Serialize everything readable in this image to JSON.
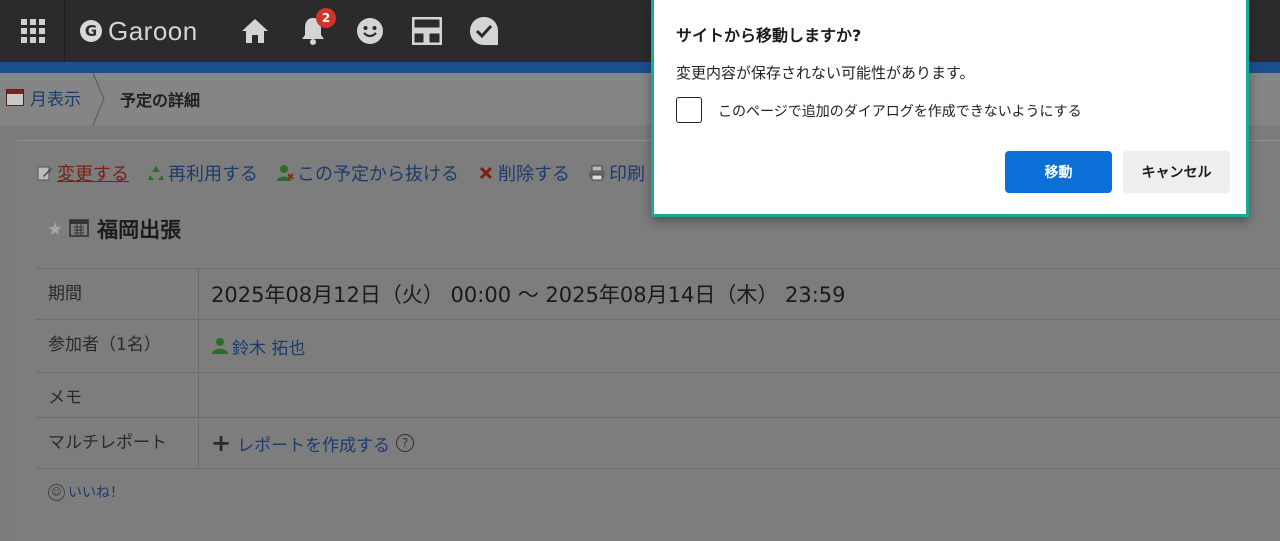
{
  "app": {
    "logo_text": "Garoon",
    "logo_mark": "G"
  },
  "topbar": {
    "icons": [
      "apps-grid-icon",
      "home-icon",
      "bell-icon",
      "smiley-icon",
      "portal-icon",
      "check-icon"
    ],
    "notification_count": "2",
    "accent_color": "#1b4f8c"
  },
  "breadcrumb": {
    "parent_label": "月表示",
    "current_label": "予定の詳細"
  },
  "actions": {
    "edit": "変更する",
    "reuse": "再利用する",
    "leave": "この予定から抜ける",
    "delete": "削除する",
    "print": "印刷"
  },
  "event": {
    "title": "福岡出張",
    "rows": [
      {
        "label": "期間",
        "value": "2025年08月12日（火） 00:00 ～ 2025年08月14日（木） 23:59"
      },
      {
        "label": "参加者（1名）",
        "value": "鈴木 拓也"
      },
      {
        "label": "メモ",
        "value": ""
      },
      {
        "label": "マルチレポート",
        "value": "レポートを作成する"
      }
    ],
    "like_label": "いいね！"
  },
  "dialog": {
    "title": "サイトから移動しますか?",
    "message": "変更内容が保存されない可能性があります。",
    "checkbox_label": "このページで追加のダイアログを作成できないようにする",
    "checkbox_checked": false,
    "confirm_label": "移動",
    "cancel_label": "キャンセル",
    "border_color": "#1aa89b",
    "confirm_color": "#0a6fd6"
  }
}
